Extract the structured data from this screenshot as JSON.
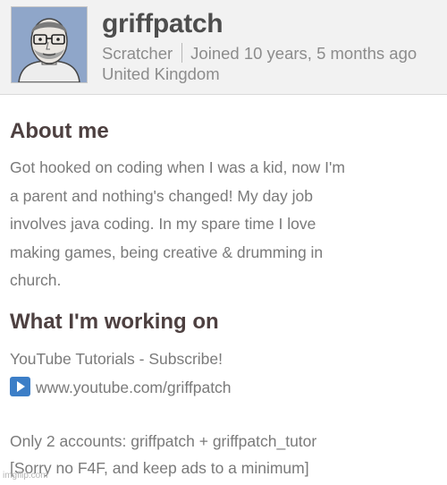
{
  "profile": {
    "username": "griffpatch",
    "role": "Scratcher",
    "joined": "Joined 10 years, 5 months ago",
    "location": "United Kingdom"
  },
  "about": {
    "title": "About me",
    "lines": [
      "Got hooked on coding when I was a kid, now I'm",
      "a parent and nothing's changed! My day job",
      "involves java coding. In my spare time I love",
      "making games, being creative & drumming in",
      "church."
    ]
  },
  "working_on": {
    "title": "What I'm working on",
    "line1": "YouTube Tutorials - Subscribe!",
    "link": "www.youtube.com/griffpatch",
    "line2": "Only 2 accounts: griffpatch + griffpatch_tutor",
    "line3": "[Sorry no F4F, and keep ads to a minimum]"
  },
  "watermark": "imgflip.com",
  "colors": {
    "header_bg": "#f2f2f2",
    "username": "#4d4d4d",
    "meta": "#8c8c8c",
    "heading": "#4d4040",
    "body_text": "#7a7a7a",
    "play_icon": "#3c7ec7"
  },
  "icons": {
    "avatar": "avatar-portrait",
    "link_icon": "play-icon"
  }
}
